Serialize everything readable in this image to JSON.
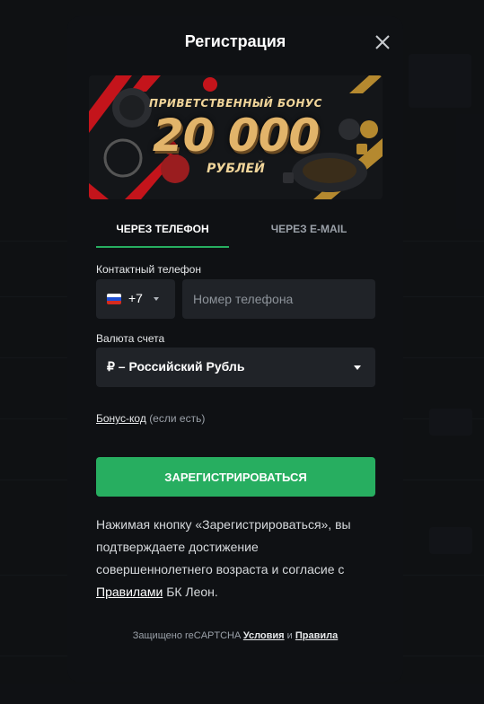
{
  "modal": {
    "title": "Регистрация"
  },
  "banner": {
    "line1": "ПРИВЕТСТВЕННЫЙ БОНУС",
    "amount": "20 000",
    "line2": "РУБЛЕЙ"
  },
  "tabs": {
    "phone": "ЧЕРЕЗ ТЕЛЕФОН",
    "email": "ЧЕРЕЗ E-MAIL",
    "active": "phone"
  },
  "phone_field": {
    "label": "Контактный телефон",
    "dial_code": "+7",
    "country_flag": "russia-flag",
    "placeholder": "Номер телефона",
    "value": ""
  },
  "currency_field": {
    "label": "Валюта счета",
    "value": "₽ – Российский Рубль"
  },
  "bonus": {
    "link": "Бонус-код",
    "hint": "(если есть)"
  },
  "register_button": {
    "label": "ЗАРЕГИСТРИРОВАТЬСЯ",
    "color": "#27ae60"
  },
  "terms": {
    "text_before": "Нажимая кнопку «Зарегистрироваться», вы подтверждаете достижение совершеннолетнего возраста и согласие с",
    "link": "Правилами",
    "text_after": "БК Леон."
  },
  "captcha": {
    "prefix": "Защищено reCAPTCHA",
    "terms_link": "Условия",
    "conjunction": "и",
    "rules_link": "Правила"
  }
}
